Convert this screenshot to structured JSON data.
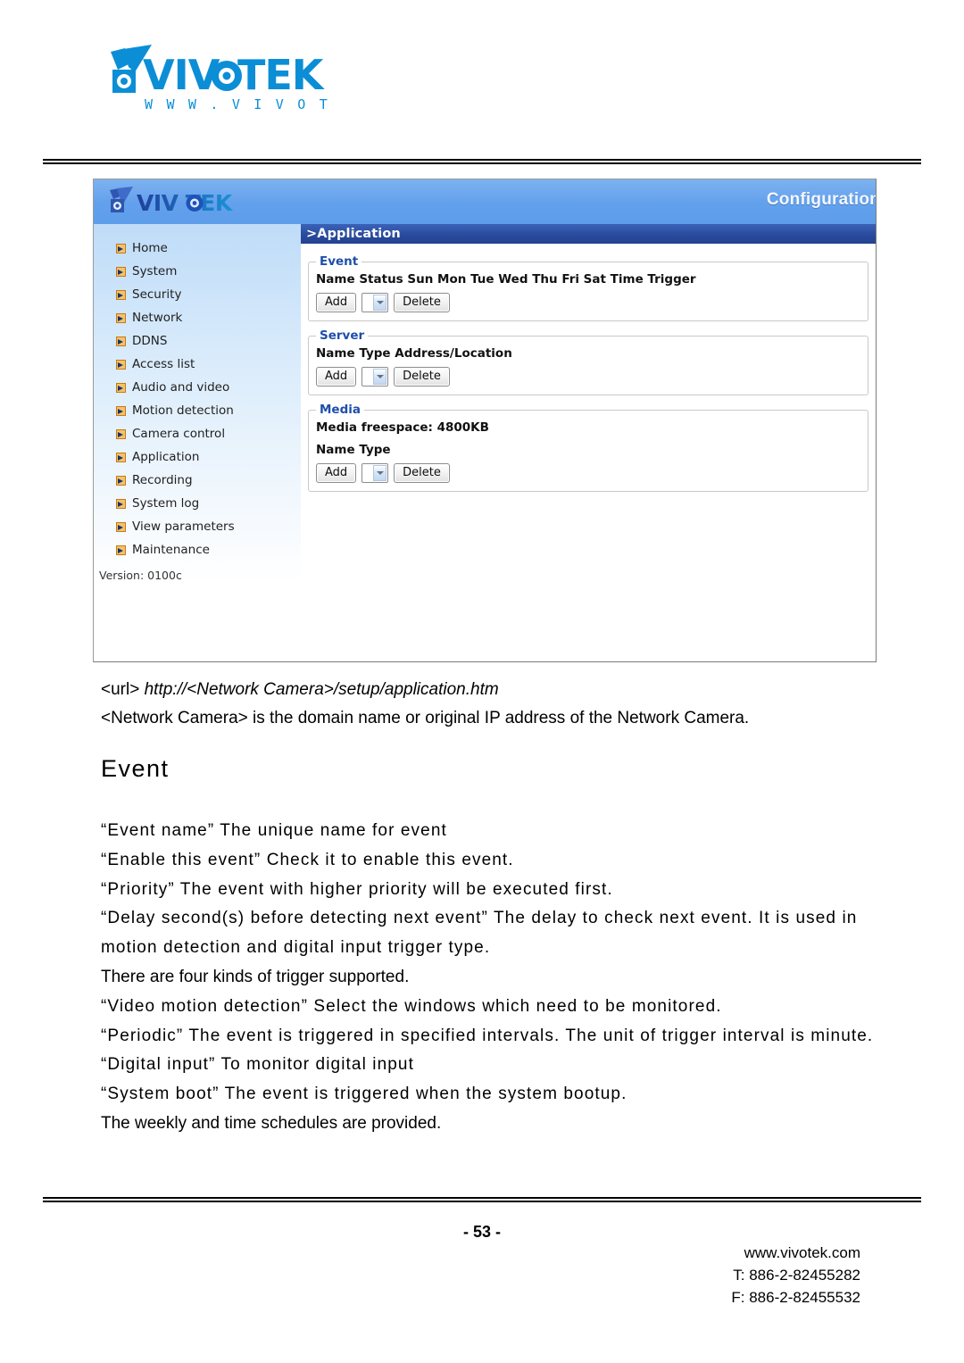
{
  "page": {
    "brand_logo_text": "VIVOTEK",
    "brand_logo_sub": "WWW.VIVOTEK.COM",
    "page_number": "- 53 -"
  },
  "screenshot": {
    "header": {
      "logo_text": "VIVOTEK",
      "mode_label": "Configuration"
    },
    "breadcrumb": ">Application",
    "sidebar": {
      "items": [
        {
          "label": "Home",
          "icon": "arrow-bullet-icon"
        },
        {
          "label": "System",
          "icon": "arrow-bullet-icon"
        },
        {
          "label": "Security",
          "icon": "arrow-bullet-icon"
        },
        {
          "label": "Network",
          "icon": "arrow-bullet-icon"
        },
        {
          "label": "DDNS",
          "icon": "arrow-bullet-icon"
        },
        {
          "label": "Access list",
          "icon": "arrow-bullet-icon"
        },
        {
          "label": "Audio and video",
          "icon": "arrow-bullet-icon"
        },
        {
          "label": "Motion detection",
          "icon": "arrow-bullet-icon"
        },
        {
          "label": "Camera control",
          "icon": "arrow-bullet-icon"
        },
        {
          "label": "Application",
          "icon": "arrow-bullet-icon"
        },
        {
          "label": "Recording",
          "icon": "arrow-bullet-icon"
        },
        {
          "label": "System log",
          "icon": "arrow-bullet-icon"
        },
        {
          "label": "View parameters",
          "icon": "arrow-bullet-icon"
        },
        {
          "label": "Maintenance",
          "icon": "arrow-bullet-icon"
        }
      ],
      "version": "Version: 0100c"
    },
    "panes": {
      "event": {
        "legend": "Event",
        "columns": "Name Status Sun Mon Tue Wed Thu Fri Sat Time Trigger",
        "add_label": "Add",
        "delete_label": "Delete",
        "select_value": ""
      },
      "server": {
        "legend": "Server",
        "columns": "Name Type Address/Location",
        "add_label": "Add",
        "delete_label": "Delete",
        "select_value": ""
      },
      "media": {
        "legend": "Media",
        "freespace": "Media freespace: 4800KB",
        "columns": "Name Type",
        "add_label": "Add",
        "delete_label": "Delete",
        "select_value": ""
      }
    }
  },
  "doc": {
    "url_label": "<url>",
    "url_value": "http://<Network Camera>/setup/application.htm",
    "url_note": "<Network Camera> is the domain name or original IP address of the Network Camera.",
    "section_title": "Event",
    "paragraphs": [
      "“Event name” The unique name for event",
      "“Enable this event” Check it to enable this event.",
      "“Priority” The event with higher priority will be executed first.",
      "“Delay second(s) before detecting next event” The delay to check next event. It is used in motion detection and digital input trigger type.",
      "There are four kinds of trigger supported.",
      "“Video motion detection” Select the windows which need to be monitored.",
      "“Periodic” The event is triggered in specified intervals. The unit of trigger interval is minute.",
      "“Digital input” To monitor digital input",
      "“System boot” The event is triggered when the system bootup.",
      "The weekly and time schedules are provided."
    ]
  },
  "footer": {
    "website": "www.vivotek.com",
    "tel": "T: 886-2-82455282",
    "fax": "F: 886-2-82455532"
  },
  "colors": {
    "brand_blue": "#0b8ed6",
    "header_blue": "#62a0ec",
    "breadcrumb_blue": "#29499c",
    "legend_blue": "#1e4faa",
    "bullet_orange": "#f6c16b"
  }
}
